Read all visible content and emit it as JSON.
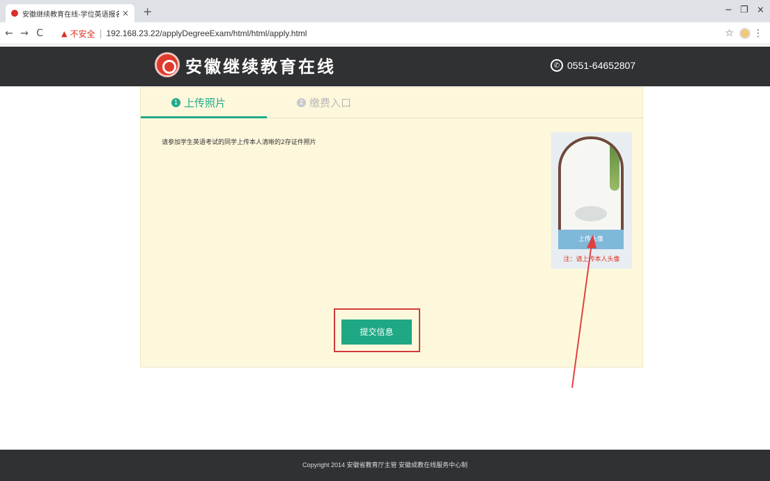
{
  "browser": {
    "tab_title": "安徽继续教育在线-学位英语报名",
    "tab_close": "×",
    "new_tab": "+",
    "insecure_label": "不安全",
    "separator": "|",
    "url": "192.168.23.22/applyDegreeExam/html/html/apply.html",
    "back": "←",
    "forward": "→",
    "reload": "C",
    "star": "☆",
    "menu": "⋮",
    "minimize": "−",
    "restore": "❐",
    "close": "×"
  },
  "header": {
    "logo_text": "安徽继续教育在线",
    "phone": "0551-64652807"
  },
  "steps": [
    {
      "num": "1",
      "label": "上传照片"
    },
    {
      "num": "2",
      "label": "缴费入口"
    }
  ],
  "instruction": "请参加学生英语考试的同学上传本人清晰的2存证件照片",
  "photo": {
    "upload_label": "上传头像",
    "note": "注：请上传本人头像"
  },
  "submit_label": "提交信息",
  "footer": "Copyright 2014 安徽省教育厅主管 安徽成教在线服务中心制",
  "colors": {
    "accent": "#23a98b",
    "header_bg": "#303133",
    "panel_bg": "#fdf8dc",
    "annotation": "#d23a3a"
  }
}
